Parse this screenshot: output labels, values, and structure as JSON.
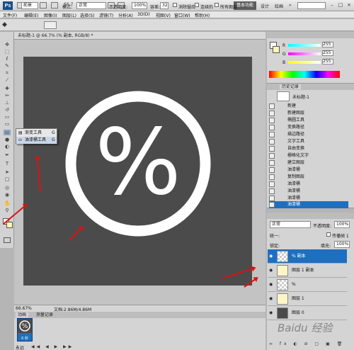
{
  "titlebar": {
    "logo": "Ps",
    "zoom": "66.7",
    "workspace": "基本功能",
    "ws_design": "设计",
    "ws_paint": "绘画",
    "more": "»",
    "min": "–",
    "max": "□",
    "close": "×"
  },
  "menu": [
    "文件(F)",
    "编辑(E)",
    "图像(I)",
    "图层(L)",
    "选择(S)",
    "滤镜(T)",
    "分析(A)",
    "3D(D)",
    "视图(V)",
    "窗口(W)",
    "帮助(H)"
  ],
  "options": {
    "fill_sel": "前景",
    "mode_label": "模式:",
    "mode_value": "正常",
    "opacity_label": "不透明度:",
    "opacity_value": "100%",
    "tolerance_label": "容差:",
    "tolerance_value": "32",
    "antialias": "消除锯齿",
    "contiguous": "连续的",
    "all_layers": "所有图层"
  },
  "document": {
    "tab": "未标题-1 @ 66.7% (% 副本, RGB/8) *",
    "zoom": "66.67%",
    "status": "文档:2.86M/4.86M"
  },
  "canvas_art": {
    "symbol": "%",
    "bg": "#4b4b4b",
    "fg": "#ffffff"
  },
  "popup": {
    "items": [
      "渐变工具",
      "油漆桶工具"
    ],
    "keys": [
      "G",
      "G"
    ]
  },
  "color": {
    "r": "255",
    "g": "255",
    "b": "255",
    "r_label": "R",
    "g_label": "G",
    "b_label": "B"
  },
  "history": {
    "tab1": "历史记录",
    "doc": "未标题-1",
    "items": [
      "新建",
      "新建图层",
      "椭圆工具",
      "变换路径",
      "描边路径",
      "文字工具",
      "自由变换",
      "栅格化文字",
      "建立图层",
      "油漆桶",
      "复制图层",
      "油漆桶",
      "油漆桶",
      "油漆桶",
      "油漆桶"
    ]
  },
  "layers": {
    "blend": "正常",
    "opacity_label": "不透明度:",
    "opacity": "100%",
    "unify": "统一:",
    "propagate": "传播帧 1",
    "lock": "锁定:",
    "fill_label": "填充:",
    "fill": "100%",
    "rows": [
      {
        "name": "% 副本"
      },
      {
        "name": "图层 1 副本"
      },
      {
        "name": "%"
      },
      {
        "name": "图层 1"
      },
      {
        "name": "图层 0"
      }
    ]
  },
  "anim": {
    "tab1": "动画",
    "tab2": "测量记录",
    "frame_time": "0 秒",
    "loop": "永远"
  },
  "watermark": "Baidu 经验"
}
